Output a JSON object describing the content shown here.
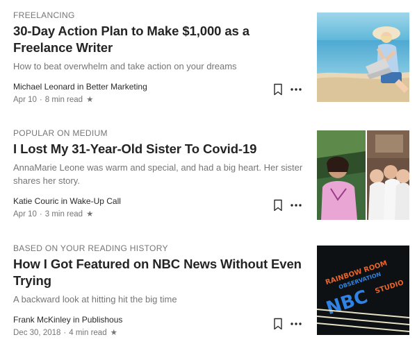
{
  "articles": [
    {
      "category": "FREELANCING",
      "title": "30-Day Action Plan to Make $1,000 as a Freelance Writer",
      "subtitle": "How to beat overwhelm and take action on your dreams",
      "author_line": "Michael Leonard in Better Marketing",
      "date": "Apr 10",
      "read_time": "8 min read",
      "star": "★",
      "thumbnail_desc": "beach-laptop-photo"
    },
    {
      "category": "POPULAR ON MEDIUM",
      "title": "I Lost My 31-Year-Old Sister To Covid-19",
      "subtitle": "AnnaMarie Leone was warm and special, and had a big heart. Her sister shares her story.",
      "author_line": "Katie Couric in Wake-Up Call",
      "date": "Apr 10",
      "read_time": "3 min read",
      "star": "★",
      "thumbnail_desc": "sisters-photo"
    },
    {
      "category": "BASED ON YOUR READING HISTORY",
      "title": "How I Got Featured on NBC News Without Even Trying",
      "subtitle": "A backward look at hitting hit the big time",
      "author_line": "Frank McKinley in Publishous",
      "date": "Dec 30, 2018",
      "read_time": "4 min read",
      "star": "★",
      "thumbnail_desc": "neon-sign-photo",
      "neon": {
        "line1": "RAINBOW ROOM",
        "line2": "OBSERVATION",
        "line3": "NBC",
        "line4": "STUDIO"
      }
    }
  ],
  "icons": {
    "bookmark": "bookmark-icon",
    "more": "more-options-icon"
  },
  "colors": {
    "text_primary": "#242424",
    "text_secondary": "#757575"
  }
}
